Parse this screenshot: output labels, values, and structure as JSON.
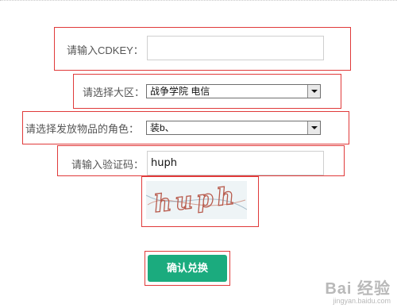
{
  "form": {
    "cdkey": {
      "label": "请输入CDKEY：",
      "value": ""
    },
    "region": {
      "label": "请选择大区：",
      "selected": "战争学院 电信"
    },
    "role": {
      "label": "请选择发放物品的角色：",
      "selected": "装b、"
    },
    "captcha": {
      "label": "请输入验证码：",
      "value": "huph",
      "image_text": "huph"
    },
    "submit_label": "确认兑换"
  },
  "watermark": {
    "main": "Bai 经验",
    "sub": "jingyan.baidu.com"
  },
  "colors": {
    "highlight_border": "#e03a3a",
    "button_bg": "#1bab7e"
  }
}
